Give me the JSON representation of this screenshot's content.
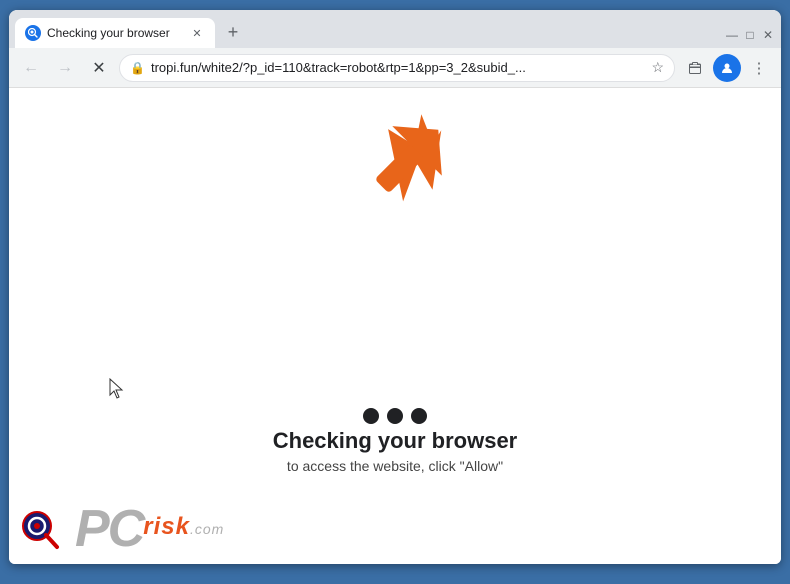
{
  "browser": {
    "tab": {
      "title": "Checking your browser",
      "favicon": "●"
    },
    "new_tab_label": "+",
    "controls": {
      "minimize": "—",
      "maximize": "□",
      "close": "✕"
    },
    "nav": {
      "back": "←",
      "forward": "→",
      "reload": "✕"
    },
    "url": "tropi.fun/white2/?p_id=110&track=robot&rtp=1&pp=3_2&subid_...",
    "star": "☆",
    "extensions_label": "🧩",
    "profile_label": "▾",
    "menu_label": "⋮"
  },
  "page": {
    "heading": "Checking your browser",
    "subtext": "to access the website, click \"Allow\"",
    "dots": [
      "•",
      "•",
      "•"
    ]
  },
  "watermark": {
    "pc_text": "PC",
    "risk_text": "risk",
    "com_text": ".com"
  }
}
